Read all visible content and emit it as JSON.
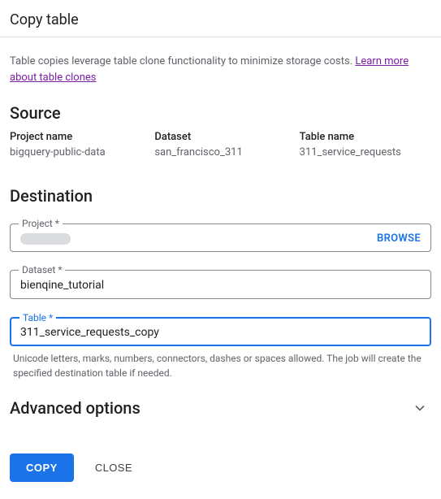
{
  "title": "Copy table",
  "info": {
    "text": "Table copies leverage table clone functionality to minimize storage costs. ",
    "link": "Learn more about table clones"
  },
  "source": {
    "heading": "Source",
    "project_label": "Project name",
    "project_value": "bigquery-public-data",
    "dataset_label": "Dataset",
    "dataset_value": "san_francisco_311",
    "table_label": "Table name",
    "table_value": "311_service_requests"
  },
  "destination": {
    "heading": "Destination",
    "project_label": "Project *",
    "browse": "BROWSE",
    "dataset_label": "Dataset *",
    "dataset_value": "bienqine_tutorial",
    "table_label": "Table *",
    "table_value": "311_service_requests_copy",
    "table_helper": "Unicode letters, marks, numbers, connectors, dashes or spaces allowed. The job will create the specified destination table if needed."
  },
  "advanced": "Advanced options",
  "buttons": {
    "copy": "COPY",
    "close": "CLOSE"
  }
}
